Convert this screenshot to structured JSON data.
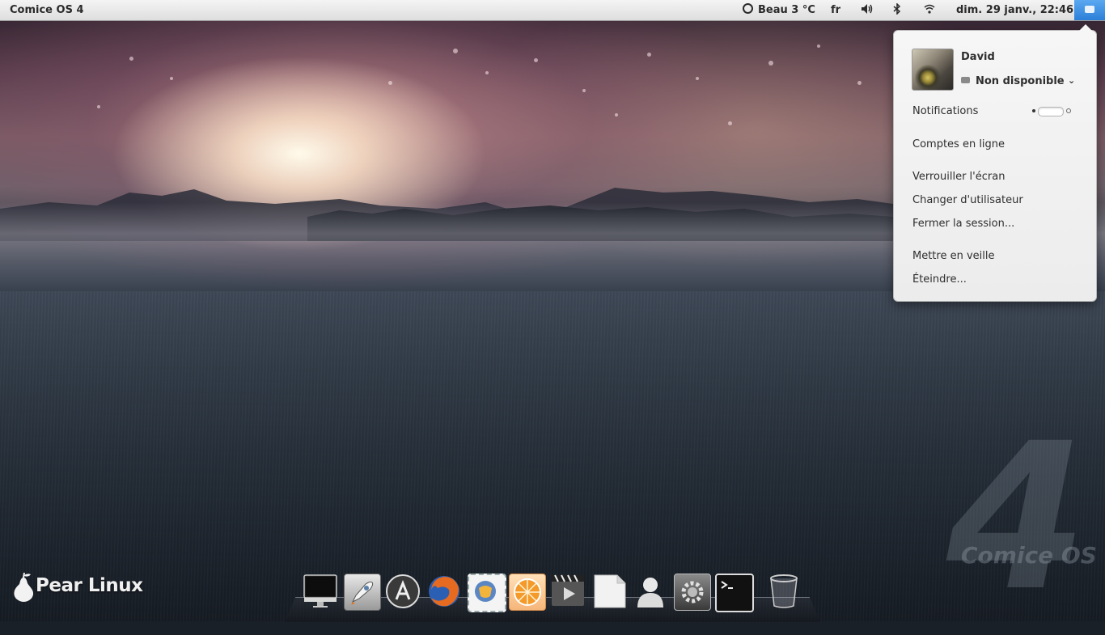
{
  "top_panel": {
    "activities_label": "Comice OS 4",
    "weather": "Beau 3 °C",
    "keyboard_layout": "fr",
    "clock": "dim. 29 janv., 22:46"
  },
  "user_menu": {
    "user_name": "David",
    "status": "Non disponible",
    "notifications_label": "Notifications",
    "notifications_enabled": true,
    "items": [
      "Comptes en ligne",
      "Verrouiller l'écran",
      "Changer d'utilisateur",
      "Fermer la session...",
      "Mettre en veille",
      "Éteindre..."
    ]
  },
  "desktop": {
    "logo_text": "Pear Linux",
    "watermark_number": "4",
    "watermark_text": "Comice OS"
  },
  "dock": {
    "icons": [
      "computer-icon",
      "rocket-launcher-icon",
      "app-store-icon",
      "firefox-icon",
      "mail-stamp-icon",
      "music-player-icon",
      "video-player-icon",
      "text-editor-icon",
      "contacts-icon",
      "settings-icon",
      "terminal-icon",
      "trash-icon"
    ]
  },
  "colors": {
    "panel_bg": "#e6e6e6",
    "user_button_active": "#3b8ee3",
    "menu_bg": "#f2f2f2"
  }
}
